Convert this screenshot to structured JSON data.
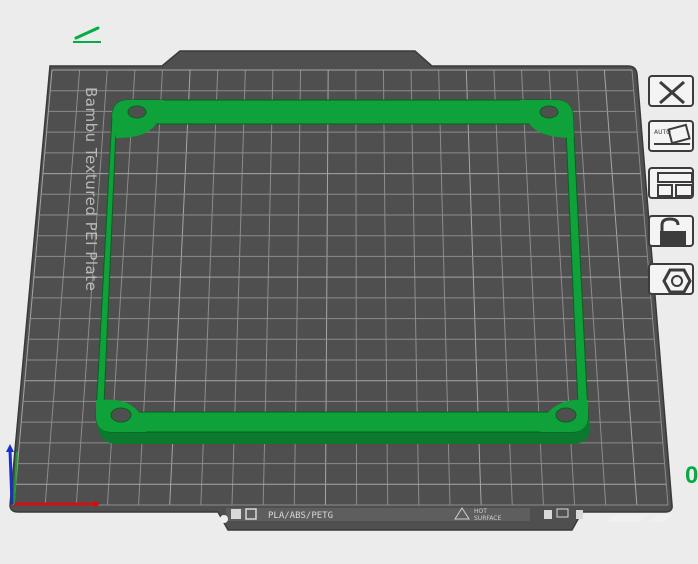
{
  "plate": {
    "name": "Bambu Textured PEI Plate",
    "filament_types": "PLA/ABS/PETG",
    "surface_line1": "HOT",
    "surface_line2": "SURFACE"
  },
  "toolbar": {
    "close_label": "close-icon",
    "auto_orient_label": "AUTO",
    "arrange_label": "arrange-icon",
    "lock_label": "lock-icon",
    "settings_label": "settings-icon"
  },
  "right_edge_badge": "0",
  "colors": {
    "accent": "#00ae42",
    "plate": "#4d4d4d",
    "grid": "#8a8a8a",
    "background": "#ececec"
  }
}
